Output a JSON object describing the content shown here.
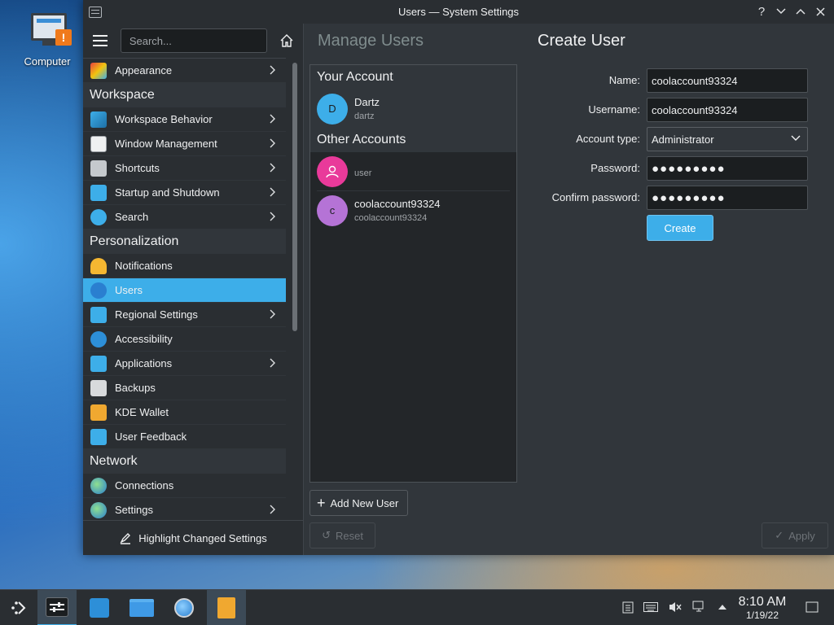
{
  "desktop": {
    "icon_label": "Computer"
  },
  "window": {
    "title": "Users — System Settings"
  },
  "sidebar": {
    "search_placeholder": "Search...",
    "items": [
      {
        "type": "item",
        "label": "Appearance",
        "icon": "appearance-icon",
        "chevron": true
      },
      {
        "type": "section",
        "label": "Workspace"
      },
      {
        "type": "item",
        "label": "Workspace Behavior",
        "icon": "workspace-behavior-icon",
        "chevron": true
      },
      {
        "type": "item",
        "label": "Window Management",
        "icon": "window-management-icon",
        "chevron": true
      },
      {
        "type": "item",
        "label": "Shortcuts",
        "icon": "keyboard-icon",
        "chevron": true
      },
      {
        "type": "item",
        "label": "Startup and Shutdown",
        "icon": "startup-icon",
        "chevron": true
      },
      {
        "type": "item",
        "label": "Search",
        "icon": "search-icon",
        "chevron": true
      },
      {
        "type": "section",
        "label": "Personalization"
      },
      {
        "type": "item",
        "label": "Notifications",
        "icon": "bell-icon",
        "chevron": false
      },
      {
        "type": "item",
        "label": "Users",
        "icon": "users-icon",
        "chevron": false,
        "active": true
      },
      {
        "type": "item",
        "label": "Regional Settings",
        "icon": "regional-icon",
        "chevron": true
      },
      {
        "type": "item",
        "label": "Accessibility",
        "icon": "accessibility-icon",
        "chevron": false
      },
      {
        "type": "item",
        "label": "Applications",
        "icon": "applications-icon",
        "chevron": true
      },
      {
        "type": "item",
        "label": "Backups",
        "icon": "backups-icon",
        "chevron": false
      },
      {
        "type": "item",
        "label": "KDE Wallet",
        "icon": "wallet-icon",
        "chevron": false
      },
      {
        "type": "item",
        "label": "User Feedback",
        "icon": "feedback-icon",
        "chevron": false
      },
      {
        "type": "section",
        "label": "Network"
      },
      {
        "type": "item",
        "label": "Connections",
        "icon": "globe-icon",
        "chevron": false
      },
      {
        "type": "item",
        "label": "Settings",
        "icon": "globe-icon",
        "chevron": true
      }
    ],
    "footer_label": "Highlight Changed Settings"
  },
  "main": {
    "left_heading": "Manage Users",
    "right_heading": "Create User",
    "your_account_label": "Your Account",
    "other_accounts_label": "Other Accounts",
    "current_user": {
      "name": "Dartz",
      "username": "dartz",
      "initial": "D"
    },
    "other_users": [
      {
        "name": "",
        "username": "user",
        "initial": ""
      },
      {
        "name": "coolaccount93324",
        "username": "coolaccount93324",
        "initial": "c"
      }
    ],
    "add_user_label": "Add New User",
    "reset_label": "Reset",
    "apply_label": "Apply",
    "form": {
      "name_label": "Name:",
      "name_value": "coolaccount93324",
      "username_label": "Username:",
      "username_value": "coolaccount93324",
      "account_type_label": "Account type:",
      "account_type_value": "Administrator",
      "password_label": "Password:",
      "password_value": "●●●●●●●●●",
      "confirm_label": "Confirm password:",
      "confirm_value": "●●●●●●●●●",
      "create_label": "Create"
    }
  },
  "taskbar": {
    "time": "8:10 AM",
    "date": "1/19/22"
  },
  "colors": {
    "accent": "#3daee9",
    "window_bg": "#31363b",
    "sidebar_bg": "#2a2e32"
  }
}
